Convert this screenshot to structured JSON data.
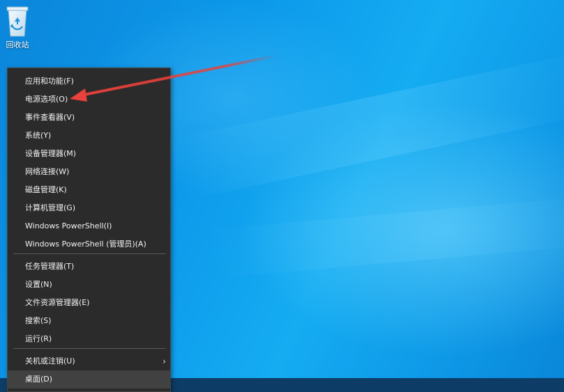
{
  "desktop": {
    "recycle_bin_label": "回收站",
    "accent_color": "#0c99ea"
  },
  "menu": {
    "items": [
      {
        "label": "应用和功能(F)"
      },
      {
        "label": "电源选项(O)"
      },
      {
        "label": "事件查看器(V)"
      },
      {
        "label": "系统(Y)"
      },
      {
        "label": "设备管理器(M)"
      },
      {
        "label": "网络连接(W)"
      },
      {
        "label": "磁盘管理(K)"
      },
      {
        "label": "计算机管理(G)"
      },
      {
        "label": "Windows PowerShell(I)"
      },
      {
        "label": "Windows PowerShell (管理员)(A)"
      },
      {
        "label": "任务管理器(T)"
      },
      {
        "label": "设置(N)"
      },
      {
        "label": "文件资源管理器(E)"
      },
      {
        "label": "搜索(S)"
      },
      {
        "label": "运行(R)"
      },
      {
        "label": "关机或注销(U)",
        "submenu_icon": "chevron-right-icon"
      },
      {
        "label": "桌面(D)"
      }
    ],
    "highlighted_item": "桌面(D)",
    "background_color": "#2b2b2b"
  },
  "annotation": {
    "arrow_color": "#e8403a",
    "points_to": "电源选项(O)"
  }
}
